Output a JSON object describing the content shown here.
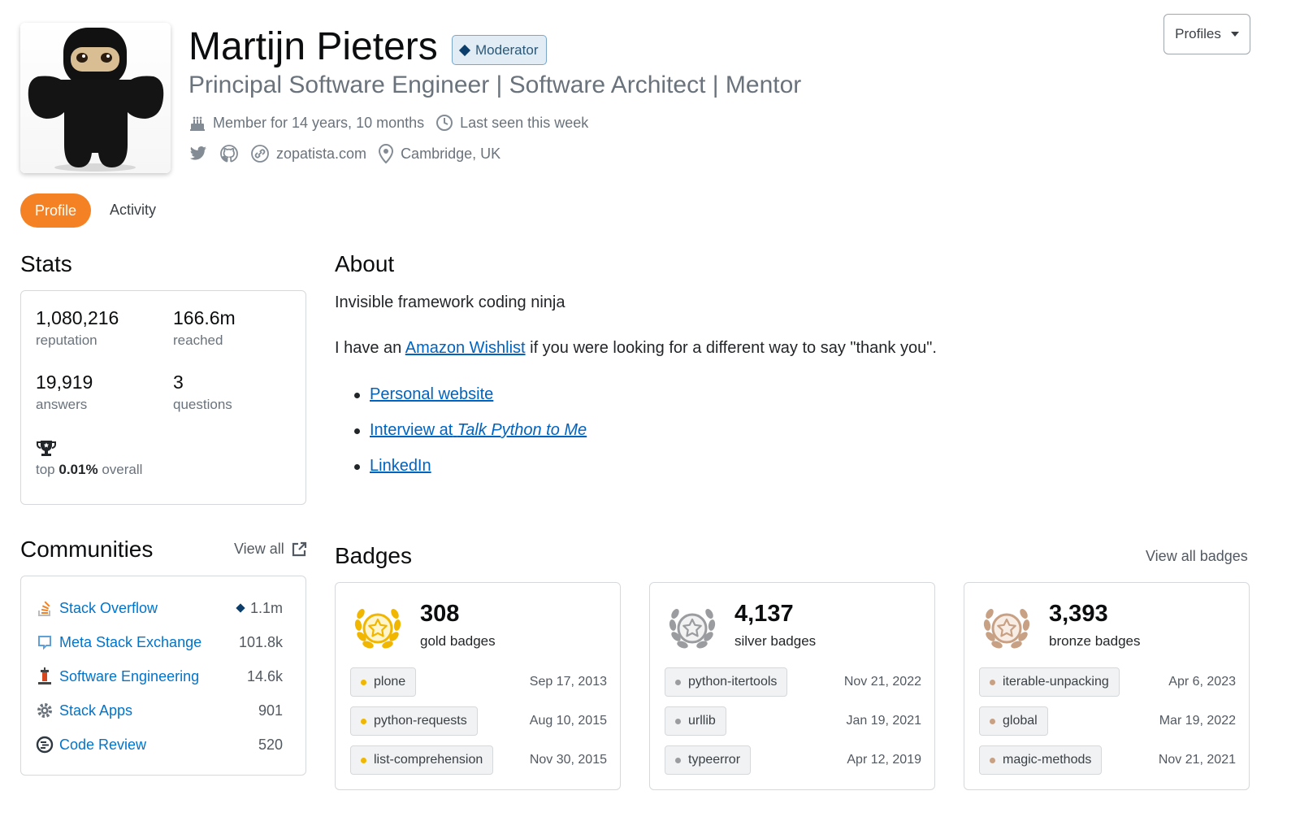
{
  "header": {
    "name": "Martijn Pieters",
    "moderator_label": "Moderator",
    "subtitle": "Principal Software Engineer | Software Architect | Mentor",
    "member_for": "Member for 14 years, 10 months",
    "last_seen": "Last seen this week",
    "website": "zopatista.com",
    "location": "Cambridge, UK",
    "profiles_button": "Profiles"
  },
  "nav": {
    "profile": "Profile",
    "activity": "Activity"
  },
  "stats": {
    "heading": "Stats",
    "reputation": "1,080,216",
    "reputation_label": "reputation",
    "reached": "166.6m",
    "reached_label": "reached",
    "answers": "19,919",
    "answers_label": "answers",
    "questions": "3",
    "questions_label": "questions",
    "top_prefix": "top",
    "top_value": "0.01%",
    "top_suffix": "overall"
  },
  "about": {
    "heading": "About",
    "line1": "Invisible framework coding ninja",
    "line2_pre": "I have an",
    "line2_link": "Amazon Wishlist",
    "line2_post": "if you were looking for a different way to say \"thank you\".",
    "links": {
      "personal": "Personal website",
      "interview_pre": "Interview at",
      "interview_em": "Talk Python to Me",
      "linkedin": "LinkedIn"
    }
  },
  "communities": {
    "heading": "Communities",
    "view_all": "View all",
    "items": [
      {
        "name": "Stack Overflow",
        "rep": "1.1m"
      },
      {
        "name": "Meta Stack Exchange",
        "rep": "101.8k"
      },
      {
        "name": "Software Engineering",
        "rep": "14.6k"
      },
      {
        "name": "Stack Apps",
        "rep": "901"
      },
      {
        "name": "Code Review",
        "rep": "520"
      }
    ]
  },
  "badges": {
    "heading": "Badges",
    "view_all": "View all badges",
    "gold": {
      "count": "308",
      "label": "gold badges",
      "color": "#f1b600",
      "items": [
        {
          "tag": "plone",
          "date": "Sep 17, 2013"
        },
        {
          "tag": "python-requests",
          "date": "Aug 10, 2015"
        },
        {
          "tag": "list-comprehension",
          "date": "Nov 30, 2015"
        }
      ]
    },
    "silver": {
      "count": "4,137",
      "label": "silver badges",
      "color": "#9a9c9f",
      "items": [
        {
          "tag": "python-itertools",
          "date": "Nov 21, 2022"
        },
        {
          "tag": "urllib",
          "date": "Jan 19, 2021"
        },
        {
          "tag": "typeerror",
          "date": "Apr 12, 2019"
        }
      ]
    },
    "bronze": {
      "count": "3,393",
      "label": "bronze badges",
      "color": "#c8a083",
      "items": [
        {
          "tag": "iterable-unpacking",
          "date": "Apr 6, 2023"
        },
        {
          "tag": "global",
          "date": "Mar 19, 2022"
        },
        {
          "tag": "magic-methods",
          "date": "Nov 21, 2021"
        }
      ]
    }
  },
  "colors": {
    "accent": "#f48225",
    "link": "#0063bf",
    "moderator": "#0c3e6b"
  }
}
